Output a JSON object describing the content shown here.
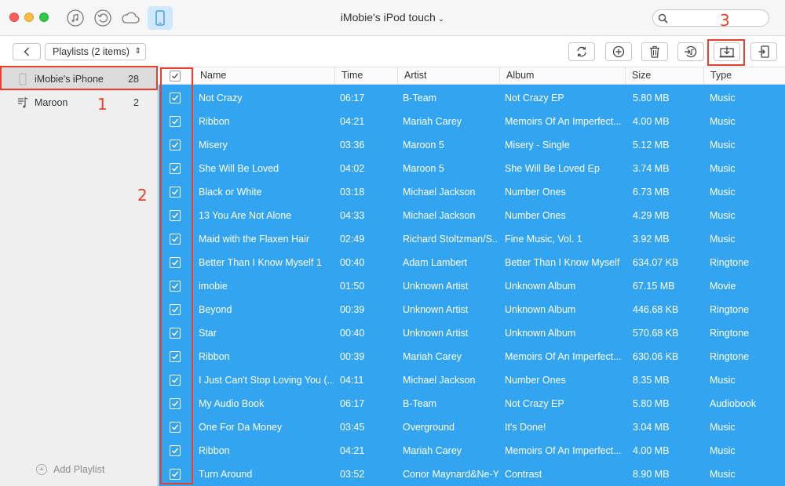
{
  "window": {
    "title": "iMobie's iPod touch",
    "title_chevron": "⌄",
    "search_placeholder": ""
  },
  "toolbar": {
    "playlist_select": "Playlists (2 items)",
    "select_arrows": "⇕",
    "buttons": [
      "refresh-icon",
      "add-icon",
      "delete-icon",
      "to-itunes-icon",
      "to-computer-icon",
      "to-device-icon"
    ]
  },
  "sidebar": {
    "items": [
      {
        "label": "iMobie's iPhone",
        "count": "28"
      },
      {
        "label": "Maroon",
        "count": "2"
      }
    ],
    "add_playlist": "Add Playlist"
  },
  "annotations": {
    "n1": "1",
    "n2": "2",
    "n3": "3",
    "color": "#e8402c"
  },
  "table": {
    "columns": [
      "Name",
      "Time",
      "Artist",
      "Album",
      "Size",
      "Type"
    ],
    "selection_color": "#33a5f0",
    "rows": [
      {
        "name": "Not Crazy",
        "time": "06:17",
        "artist": "B-Team",
        "album": "Not Crazy EP",
        "size": "5.80 MB",
        "type": "Music"
      },
      {
        "name": "Ribbon",
        "time": "04:21",
        "artist": "Mariah Carey",
        "album": "Memoirs Of An Imperfect...",
        "size": "4.00 MB",
        "type": "Music"
      },
      {
        "name": "Misery",
        "time": "03:36",
        "artist": "Maroon 5",
        "album": "Misery - Single",
        "size": "5.12 MB",
        "type": "Music"
      },
      {
        "name": "She Will Be Loved",
        "time": "04:02",
        "artist": "Maroon 5",
        "album": "She Will Be Loved Ep",
        "size": "3.74 MB",
        "type": "Music"
      },
      {
        "name": "Black or White",
        "time": "03:18",
        "artist": "Michael Jackson",
        "album": "Number Ones",
        "size": "6.73 MB",
        "type": "Music"
      },
      {
        "name": "13 You Are Not Alone",
        "time": "04:33",
        "artist": "Michael Jackson",
        "album": "Number Ones",
        "size": "4.29 MB",
        "type": "Music"
      },
      {
        "name": "Maid with the Flaxen Hair",
        "time": "02:49",
        "artist": "Richard Stoltzman/S...",
        "album": "Fine Music, Vol. 1",
        "size": "3.92 MB",
        "type": "Music"
      },
      {
        "name": "Better Than I Know Myself 1",
        "time": "00:40",
        "artist": "Adam Lambert",
        "album": "Better Than I Know Myself",
        "size": "634.07 KB",
        "type": "Ringtone"
      },
      {
        "name": "imobie",
        "time": "01:50",
        "artist": "Unknown Artist",
        "album": "Unknown Album",
        "size": "67.15 MB",
        "type": "Movie"
      },
      {
        "name": "Beyond",
        "time": "00:39",
        "artist": "Unknown Artist",
        "album": "Unknown Album",
        "size": "446.68 KB",
        "type": "Ringtone"
      },
      {
        "name": "Star",
        "time": "00:40",
        "artist": "Unknown Artist",
        "album": "Unknown Album",
        "size": "570.68 KB",
        "type": "Ringtone"
      },
      {
        "name": "Ribbon",
        "time": "00:39",
        "artist": "Mariah Carey",
        "album": "Memoirs Of An Imperfect...",
        "size": "630.06 KB",
        "type": "Ringtone"
      },
      {
        "name": "I Just Can't Stop Loving You (...",
        "time": "04:11",
        "artist": "Michael Jackson",
        "album": "Number Ones",
        "size": "8.35 MB",
        "type": "Music"
      },
      {
        "name": "My Audio Book",
        "time": "06:17",
        "artist": "B-Team",
        "album": "Not Crazy EP",
        "size": "5.80 MB",
        "type": "Audiobook"
      },
      {
        "name": "One For Da Money",
        "time": "03:45",
        "artist": "Overground",
        "album": "It's Done!",
        "size": "3.04 MB",
        "type": "Music"
      },
      {
        "name": "Ribbon",
        "time": "04:21",
        "artist": "Mariah Carey",
        "album": "Memoirs Of An Imperfect...",
        "size": "4.00 MB",
        "type": "Music"
      },
      {
        "name": "Turn Around",
        "time": "03:52",
        "artist": "Conor Maynard&Ne-Yo",
        "album": "Contrast",
        "size": "8.90 MB",
        "type": "Music"
      }
    ]
  }
}
